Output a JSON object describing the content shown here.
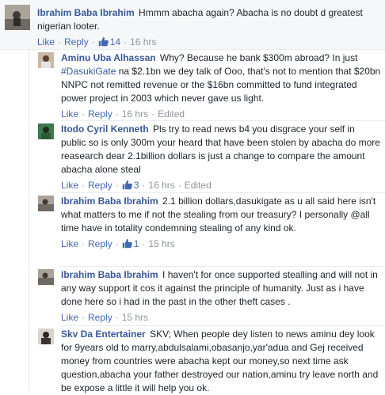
{
  "comments": [
    {
      "author": "Ibrahim Baba Ibrahim",
      "text": "Hmmm abacha again? Abacha is no doubt d greatest nigerian looter.",
      "like": "Like",
      "reply": "Reply",
      "likes": "14",
      "time": "16 hrs"
    },
    {
      "author": "Aminu Uba Alhassan",
      "text_before": "Why? Because he bank $300m abroad? In just",
      "hashtag": "#DasukiGate",
      "text_after": "na $2.1bn we dey talk of Ooo, that's not to mention that $20bn NNPC not remitted revenue or the $16bn committed to fund integrated power project in 2003 which never gave us light.",
      "like": "Like",
      "reply": "Reply",
      "time": "16 hrs",
      "edited": "Edited"
    },
    {
      "author": "Itodo Cyril Kenneth",
      "text": "Pls try to read news b4 you disgrace your self in public so is only 300m your heard that have been stolen by abacha do more reasearch dear 2.1billion dollars is just a change to compare the amount abacha alone steal",
      "like": "Like",
      "reply": "Reply",
      "likes": "3",
      "time": "16 hrs",
      "edited": "Edited"
    },
    {
      "author": "Ibrahim Baba Ibrahim",
      "text": "2.1 billion dollars,dasukigate as u all said here isn't what matters to me if not the stealing from our treasury? I personally @all time have in totality condemning stealing of any kind ok.",
      "like": "Like",
      "reply": "Reply",
      "likes": "1",
      "time": "15 hrs"
    },
    {
      "author": "Ibrahim Baba Ibrahim",
      "text": "I haven't for once supported stealling and will not in any way support it cos it against the principle of humanity. Just as i have done here so i had in the past in the other theft cases .",
      "like": "Like",
      "reply": "Reply",
      "time": "15 hrs"
    },
    {
      "author": "Skv Da Entertainer",
      "text": "SKV; When people dey listen to news aminu dey look for 9years old to marry,abdulsalami,obasanjo,yar'adua and Gej received money from countries were abacha kept our money,so next time ask question,abacha your father destroyed our nation,aminu try leave north and be expose a little it will help you ok."
    }
  ],
  "separator": "·",
  "colors": {
    "link": "#365899",
    "meta": "#90949c",
    "action": "#4267b2",
    "bg_top": "#f6f7f9"
  }
}
